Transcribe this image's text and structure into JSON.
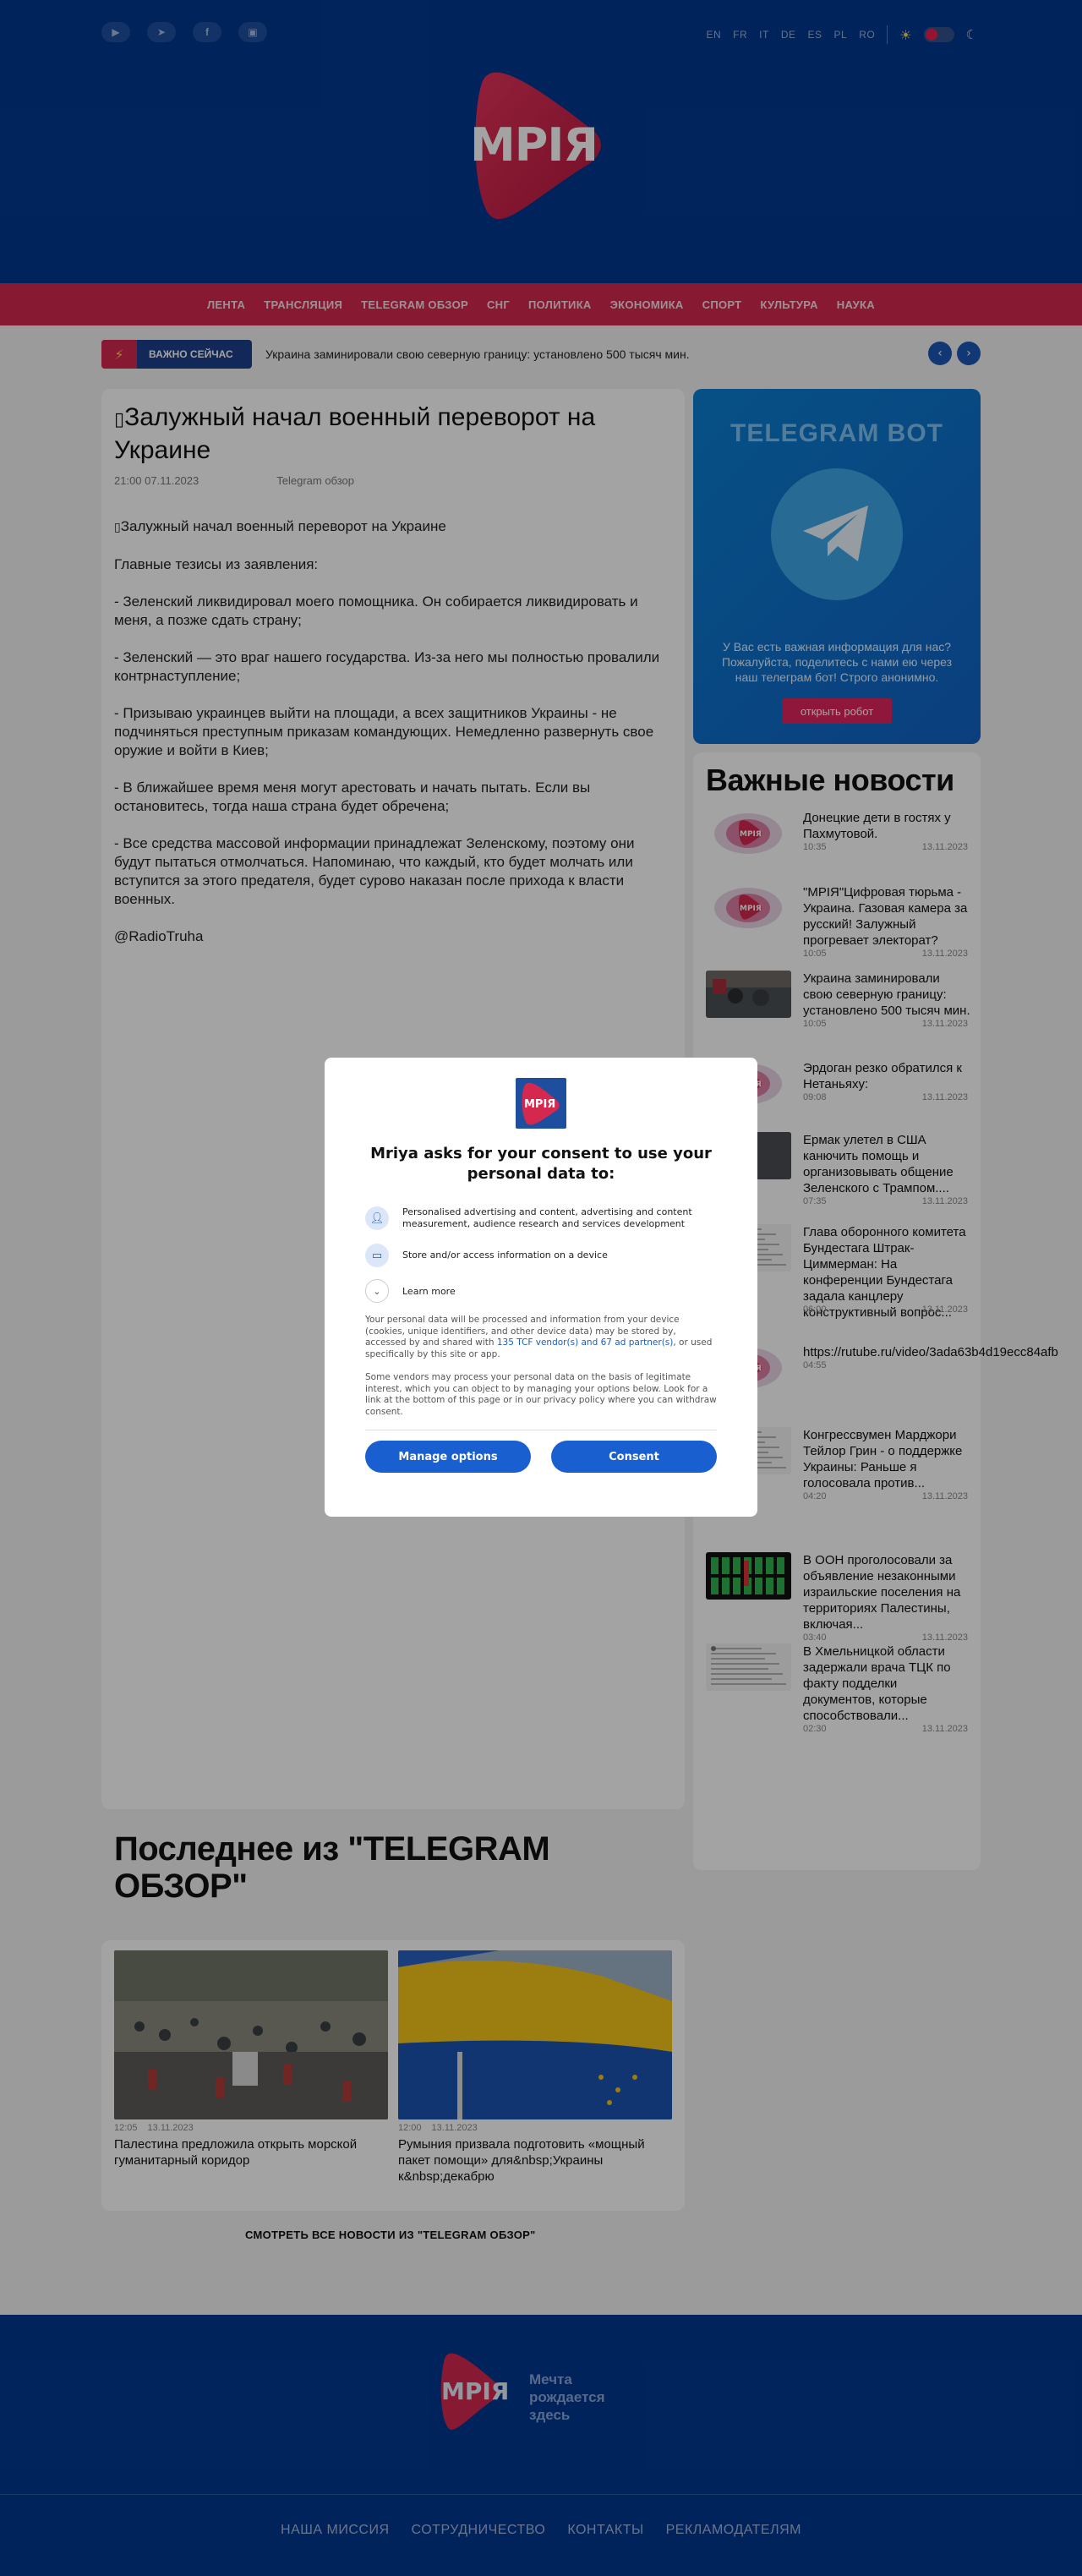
{
  "header": {
    "social": [
      "youtube-icon",
      "telegram-icon",
      "facebook-icon",
      "twitch-icon"
    ],
    "languages": [
      "EN",
      "FR",
      "IT",
      "DE",
      "ES",
      "PL",
      "RO"
    ],
    "logo_text": "МРІЯ"
  },
  "nav": [
    "ЛЕНТА",
    "ТРАНСЛЯЦИЯ",
    "TELEGRAM ОБЗОР",
    "СНГ",
    "ПОЛИТИКА",
    "ЭКОНОМИКА",
    "СПОРТ",
    "КУЛЬТУРА",
    "НАУКА"
  ],
  "ticker": {
    "badge": "ВАЖНО СЕЙЧАС",
    "text": "Украина заминировали свою северную границу: установлено 500 тысяч мин."
  },
  "article": {
    "title": "Залужный начал военный переворот на Украине",
    "time": "21:00 07.11.2023",
    "category": "Telegram обзор",
    "paragraphs": [
      "Залужный начал военный переворот на Украине",
      "Главные тезисы из заявления:",
      "- Зеленский ликвидировал моего помощника. Он собирается ликвидировать и меня, а позже сдать страну;",
      "- Зеленский — это враг нашего государства. Из-за него мы полностью провалили контрнаступление;",
      "- Призываю украинцев выйти на площади, а всех защитников Украины - не подчиняться преступным приказам командующих. Немедленно развернуть свое оружие и войти в Киев;",
      "- В ближайшее время меня могут арестовать и начать пытать. Если вы остановитесь, тогда наша страна будет обречена;",
      "- Все средства массовой информации принадлежат Зеленскому, поэтому они будут пытаться отмолчаться. Напоминаю, что каждый, кто будет молчать или вступится за этого предателя, будет сурово наказан после прихода к власти военных.",
      "@RadioTruha"
    ]
  },
  "telegram_bot": {
    "title": "TELEGRAM BOT",
    "text": "У Вас есть важная информация для нас? Пожалуйста, поделитесь с нами ею через наш телеграм бот! Строго анонимно.",
    "button": "открыть робот"
  },
  "important_news": {
    "title": "Важные новости",
    "items": [
      {
        "title": "Донецкие дети в гостях у Пахмутовой.",
        "time": "10:35",
        "date": "13.11.2023",
        "thumb": "logo"
      },
      {
        "title": "\"МРІЯ\"Цифровая тюрьма - Украина. Газовая камера за русский! Залужный прогревает электорат?",
        "time": "10:05",
        "date": "13.11.2023",
        "thumb": "logo"
      },
      {
        "title": "Украина заминировали свою северную границу: установлено 500 тысяч мин.",
        "time": "10:05",
        "date": "13.11.2023",
        "thumb": "photo"
      },
      {
        "title": "Эрдоган резко обратился к Нетаньяху:",
        "time": "09:08",
        "date": "13.11.2023",
        "thumb": "logo"
      },
      {
        "title": "Ермак улетел в США канючить помощь и организовывать общение Зеленского с Трампом....",
        "time": "07:35",
        "date": "13.11.2023",
        "thumb": "dark"
      },
      {
        "title": "Глава оборонного комитета Бундестага Штрак-Циммерман: На конференции Бундестага задала канцлеру конструктивный вопрос...",
        "time": "06:00",
        "date": "13.11.2023",
        "thumb": "doc"
      },
      {
        "title": "https://rutube.ru/video/3ada63b4d19ecc84afb",
        "time": "04:55",
        "date": "",
        "thumb": "logo"
      },
      {
        "title": "Конгрессвумен Марджори Тейлор Грин - о поддержке Украины: Раньше я голосовала против...",
        "time": "04:20",
        "date": "13.11.2023",
        "thumb": "doc"
      },
      {
        "title": "В ООН проголосовали за объявление незаконными израильские поселения на территориях Палестины, включая...",
        "time": "03:40",
        "date": "13.11.2023",
        "thumb": "table"
      },
      {
        "title": "В Хмельницкой области задержали врача ТЦК по факту подделки документов, которые способствовали...",
        "time": "02:30",
        "date": "13.11.2023",
        "thumb": "doc"
      }
    ]
  },
  "latest": {
    "heading": "Последнее из \"TELEGRAM ОБЗОР\"",
    "cards": [
      {
        "time": "12:05",
        "date": "13.11.2023",
        "title": "Палестина предложила открыть морской гуманитарный коридор"
      },
      {
        "time": "12:00",
        "date": "13.11.2023",
        "title": "Румыния призвала подготовить «мощный пакет помощи» для&nbsp;Украины к&nbsp;декабрю"
      }
    ],
    "all_link": "СМОТРЕТЬ ВСЕ НОВОСТИ ИЗ \"TELEGRAM ОБЗОР\""
  },
  "footer": {
    "logo_text": "МРІЯ",
    "slogan": "Мечта рождается здесь",
    "links": [
      "НАША МИССИЯ",
      "СОТРУДНИЧЕСТВО",
      "КОНТАКТЫ",
      "РЕКЛАМОДАТЕЛЯМ"
    ]
  },
  "consent": {
    "logo_text": "МРІЯ",
    "title": "Mriya asks for your consent to use your personal data to:",
    "purposes": [
      {
        "icon": "person-icon",
        "text": "Personalised advertising and content, advertising and content measurement, audience research and services development"
      },
      {
        "icon": "device-icon",
        "text": "Store and/or access information on a device"
      }
    ],
    "learn_more": "Learn more",
    "para1_a": "Your personal data will be processed and information from your device (cookies, unique identifiers, and other device data) may be stored by, accessed by and shared with ",
    "para1_link": "135 TCF vendor(s) and 67 ad partner(s)",
    "para1_b": ", or used specifically by this site or app.",
    "para2": "Some vendors may process your personal data on the basis of legitimate interest, which you can object to by managing your options below. Look for a link at the bottom of this page or in our privacy policy where you can withdraw consent.",
    "manage": "Manage options",
    "consent_btn": "Consent"
  },
  "colors": {
    "brand_blue": "#00388f",
    "accent_red": "#d5284f",
    "button_blue": "#1a5fcf"
  }
}
